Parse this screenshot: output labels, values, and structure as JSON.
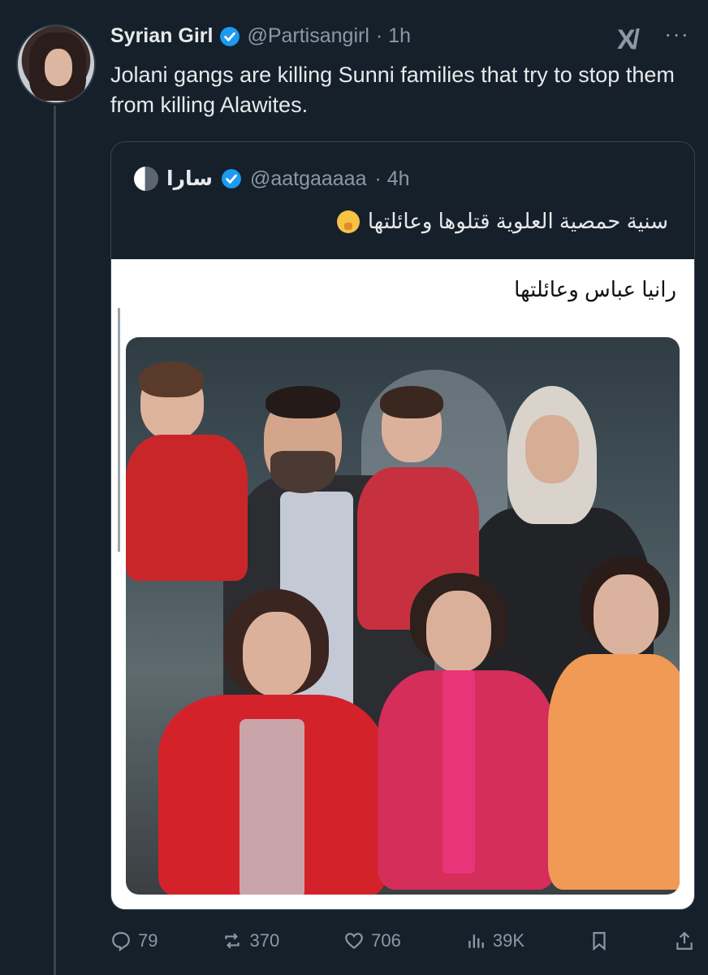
{
  "tweet": {
    "display_name": "Syrian Girl",
    "handle": "@Partisangirl",
    "time": "· 1h",
    "text": "Jolani gangs are killing Sunni families that try to stop them from killing Alawites."
  },
  "quoted": {
    "display_name": "سارا",
    "handle": "@aatgaaaaa",
    "time": "· 4h",
    "text": "سنية حمصية العلوية قتلوها وعائلتها",
    "media_caption": "رانيا عباس وعائلتها"
  },
  "actions": {
    "replies": "79",
    "reposts": "370",
    "likes": "706",
    "views": "39K"
  },
  "icons": {
    "verified": "verified-badge-icon",
    "grok": "grok-icon",
    "more": "more-icon",
    "reply": "reply-icon",
    "repost": "repost-icon",
    "like": "heart-icon",
    "views": "views-icon",
    "bookmark": "bookmark-icon",
    "share": "share-icon"
  },
  "colors": {
    "background": "#15202b",
    "text": "#e7e9ea",
    "muted": "#8b98a5",
    "verified": "#1d9bf0",
    "border": "#38444d"
  }
}
